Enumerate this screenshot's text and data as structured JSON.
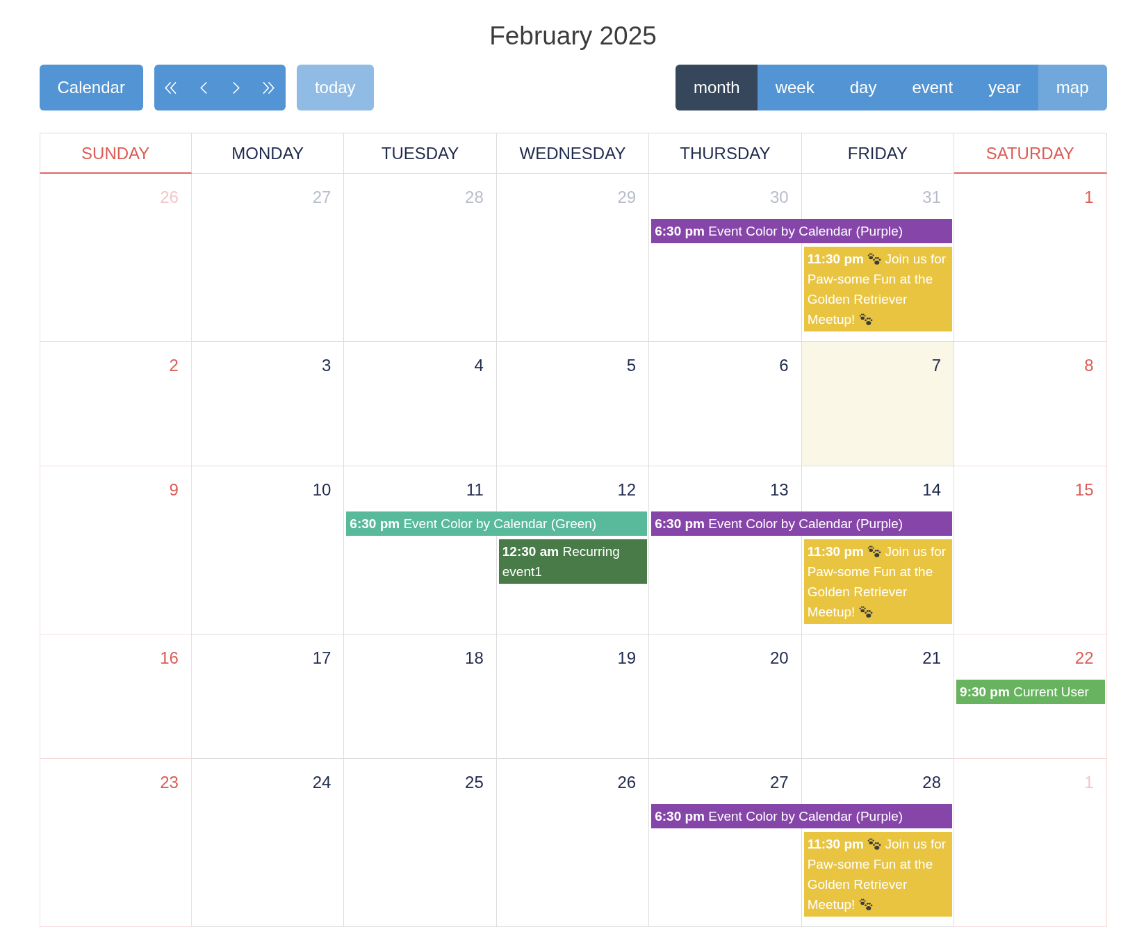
{
  "title": "February 2025",
  "toolbar": {
    "calendar_button": {
      "label": "Calendar"
    },
    "nav_buttons": [
      {
        "kind": "double_left"
      },
      {
        "kind": "left"
      },
      {
        "kind": "right"
      },
      {
        "kind": "double_right"
      }
    ],
    "today_button": {
      "label": "today",
      "disabled": true
    },
    "views": [
      {
        "label": "month",
        "selected": true,
        "secondary": false
      },
      {
        "label": "week",
        "selected": false,
        "secondary": false
      },
      {
        "label": "day",
        "selected": false,
        "secondary": false
      },
      {
        "label": "event",
        "selected": false,
        "secondary": false
      },
      {
        "label": "year",
        "selected": false,
        "secondary": false
      },
      {
        "label": "map",
        "selected": false,
        "secondary": true
      }
    ]
  },
  "calendar": {
    "weekdays": [
      {
        "label": "SUNDAY",
        "weekend": true
      },
      {
        "label": "MONDAY",
        "weekend": false
      },
      {
        "label": "TUESDAY",
        "weekend": false
      },
      {
        "label": "WEDNESDAY",
        "weekend": false
      },
      {
        "label": "THURSDAY",
        "weekend": false
      },
      {
        "label": "FRIDAY",
        "weekend": false
      },
      {
        "label": "SATURDAY",
        "weekend": true
      }
    ],
    "weeks": [
      {
        "days": [
          {
            "number": "26",
            "other_month": true,
            "today": false
          },
          {
            "number": "27",
            "other_month": true,
            "today": false
          },
          {
            "number": "28",
            "other_month": true,
            "today": false
          },
          {
            "number": "29",
            "other_month": true,
            "today": false
          },
          {
            "number": "30",
            "other_month": true,
            "today": false,
            "events": [
              {
                "time": "6:30 pm",
                "title": "Event Color by Calendar (Purple)",
                "color": "#8645a9",
                "multi_day": true,
                "decorated": false
              }
            ]
          },
          {
            "number": "31",
            "other_month": true,
            "today": false,
            "events": [
              {
                "time": "11:30 pm",
                "title": "Join us for Paw-some Fun at the Golden Retriever Meetup!",
                "color": "#e8c441",
                "multi_day": false,
                "decorated": true
              }
            ]
          },
          {
            "number": "1",
            "other_month": false,
            "today": false
          }
        ]
      },
      {
        "days": [
          {
            "number": "2",
            "other_month": false,
            "today": false
          },
          {
            "number": "3",
            "other_month": false,
            "today": false
          },
          {
            "number": "4",
            "other_month": false,
            "today": false
          },
          {
            "number": "5",
            "other_month": false,
            "today": false
          },
          {
            "number": "6",
            "other_month": false,
            "today": false
          },
          {
            "number": "7",
            "other_month": false,
            "today": true
          },
          {
            "number": "8",
            "other_month": false,
            "today": false
          }
        ]
      },
      {
        "days": [
          {
            "number": "9",
            "other_month": false,
            "today": false
          },
          {
            "number": "10",
            "other_month": false,
            "today": false
          },
          {
            "number": "11",
            "other_month": false,
            "today": false,
            "events": [
              {
                "time": "6:30 pm",
                "title": "Event Color by Calendar (Green)",
                "color": "#58ba9b",
                "multi_day": true,
                "decorated": false
              }
            ]
          },
          {
            "number": "12",
            "other_month": false,
            "today": false,
            "events": [
              {
                "time": "12:30 am",
                "title": "Recurring event1",
                "color": "#487b47",
                "multi_day": false,
                "decorated": false
              }
            ]
          },
          {
            "number": "13",
            "other_month": false,
            "today": false,
            "events": [
              {
                "time": "6:30 pm",
                "title": "Event Color by Calendar (Purple)",
                "color": "#8645a9",
                "multi_day": true,
                "decorated": false
              }
            ]
          },
          {
            "number": "14",
            "other_month": false,
            "today": false,
            "events": [
              {
                "time": "11:30 pm",
                "title": "Join us for Paw-some Fun at the Golden Retriever Meetup!",
                "color": "#e8c441",
                "multi_day": false,
                "decorated": true
              }
            ]
          },
          {
            "number": "15",
            "other_month": false,
            "today": false
          }
        ]
      },
      {
        "days": [
          {
            "number": "16",
            "other_month": false,
            "today": false
          },
          {
            "number": "17",
            "other_month": false,
            "today": false
          },
          {
            "number": "18",
            "other_month": false,
            "today": false
          },
          {
            "number": "19",
            "other_month": false,
            "today": false
          },
          {
            "number": "20",
            "other_month": false,
            "today": false
          },
          {
            "number": "21",
            "other_month": false,
            "today": false
          },
          {
            "number": "22",
            "other_month": false,
            "today": false,
            "events": [
              {
                "time": "9:30 pm",
                "title": "Current User",
                "color": "#67b35f",
                "multi_day": false,
                "decorated": false
              }
            ]
          }
        ]
      },
      {
        "days": [
          {
            "number": "23",
            "other_month": false,
            "today": false
          },
          {
            "number": "24",
            "other_month": false,
            "today": false
          },
          {
            "number": "25",
            "other_month": false,
            "today": false
          },
          {
            "number": "26",
            "other_month": false,
            "today": false
          },
          {
            "number": "27",
            "other_month": false,
            "today": false,
            "events": [
              {
                "time": "6:30 pm",
                "title": "Event Color by Calendar (Purple)",
                "color": "#8645a9",
                "multi_day": true,
                "decorated": false
              }
            ]
          },
          {
            "number": "28",
            "other_month": false,
            "today": false,
            "events": [
              {
                "time": "11:30 pm",
                "title": "Join us for Paw-some Fun at the Golden Retriever Meetup!",
                "color": "#e8c441",
                "multi_day": false,
                "decorated": true
              }
            ]
          },
          {
            "number": "1",
            "other_month": true,
            "today": false
          }
        ]
      }
    ]
  }
}
